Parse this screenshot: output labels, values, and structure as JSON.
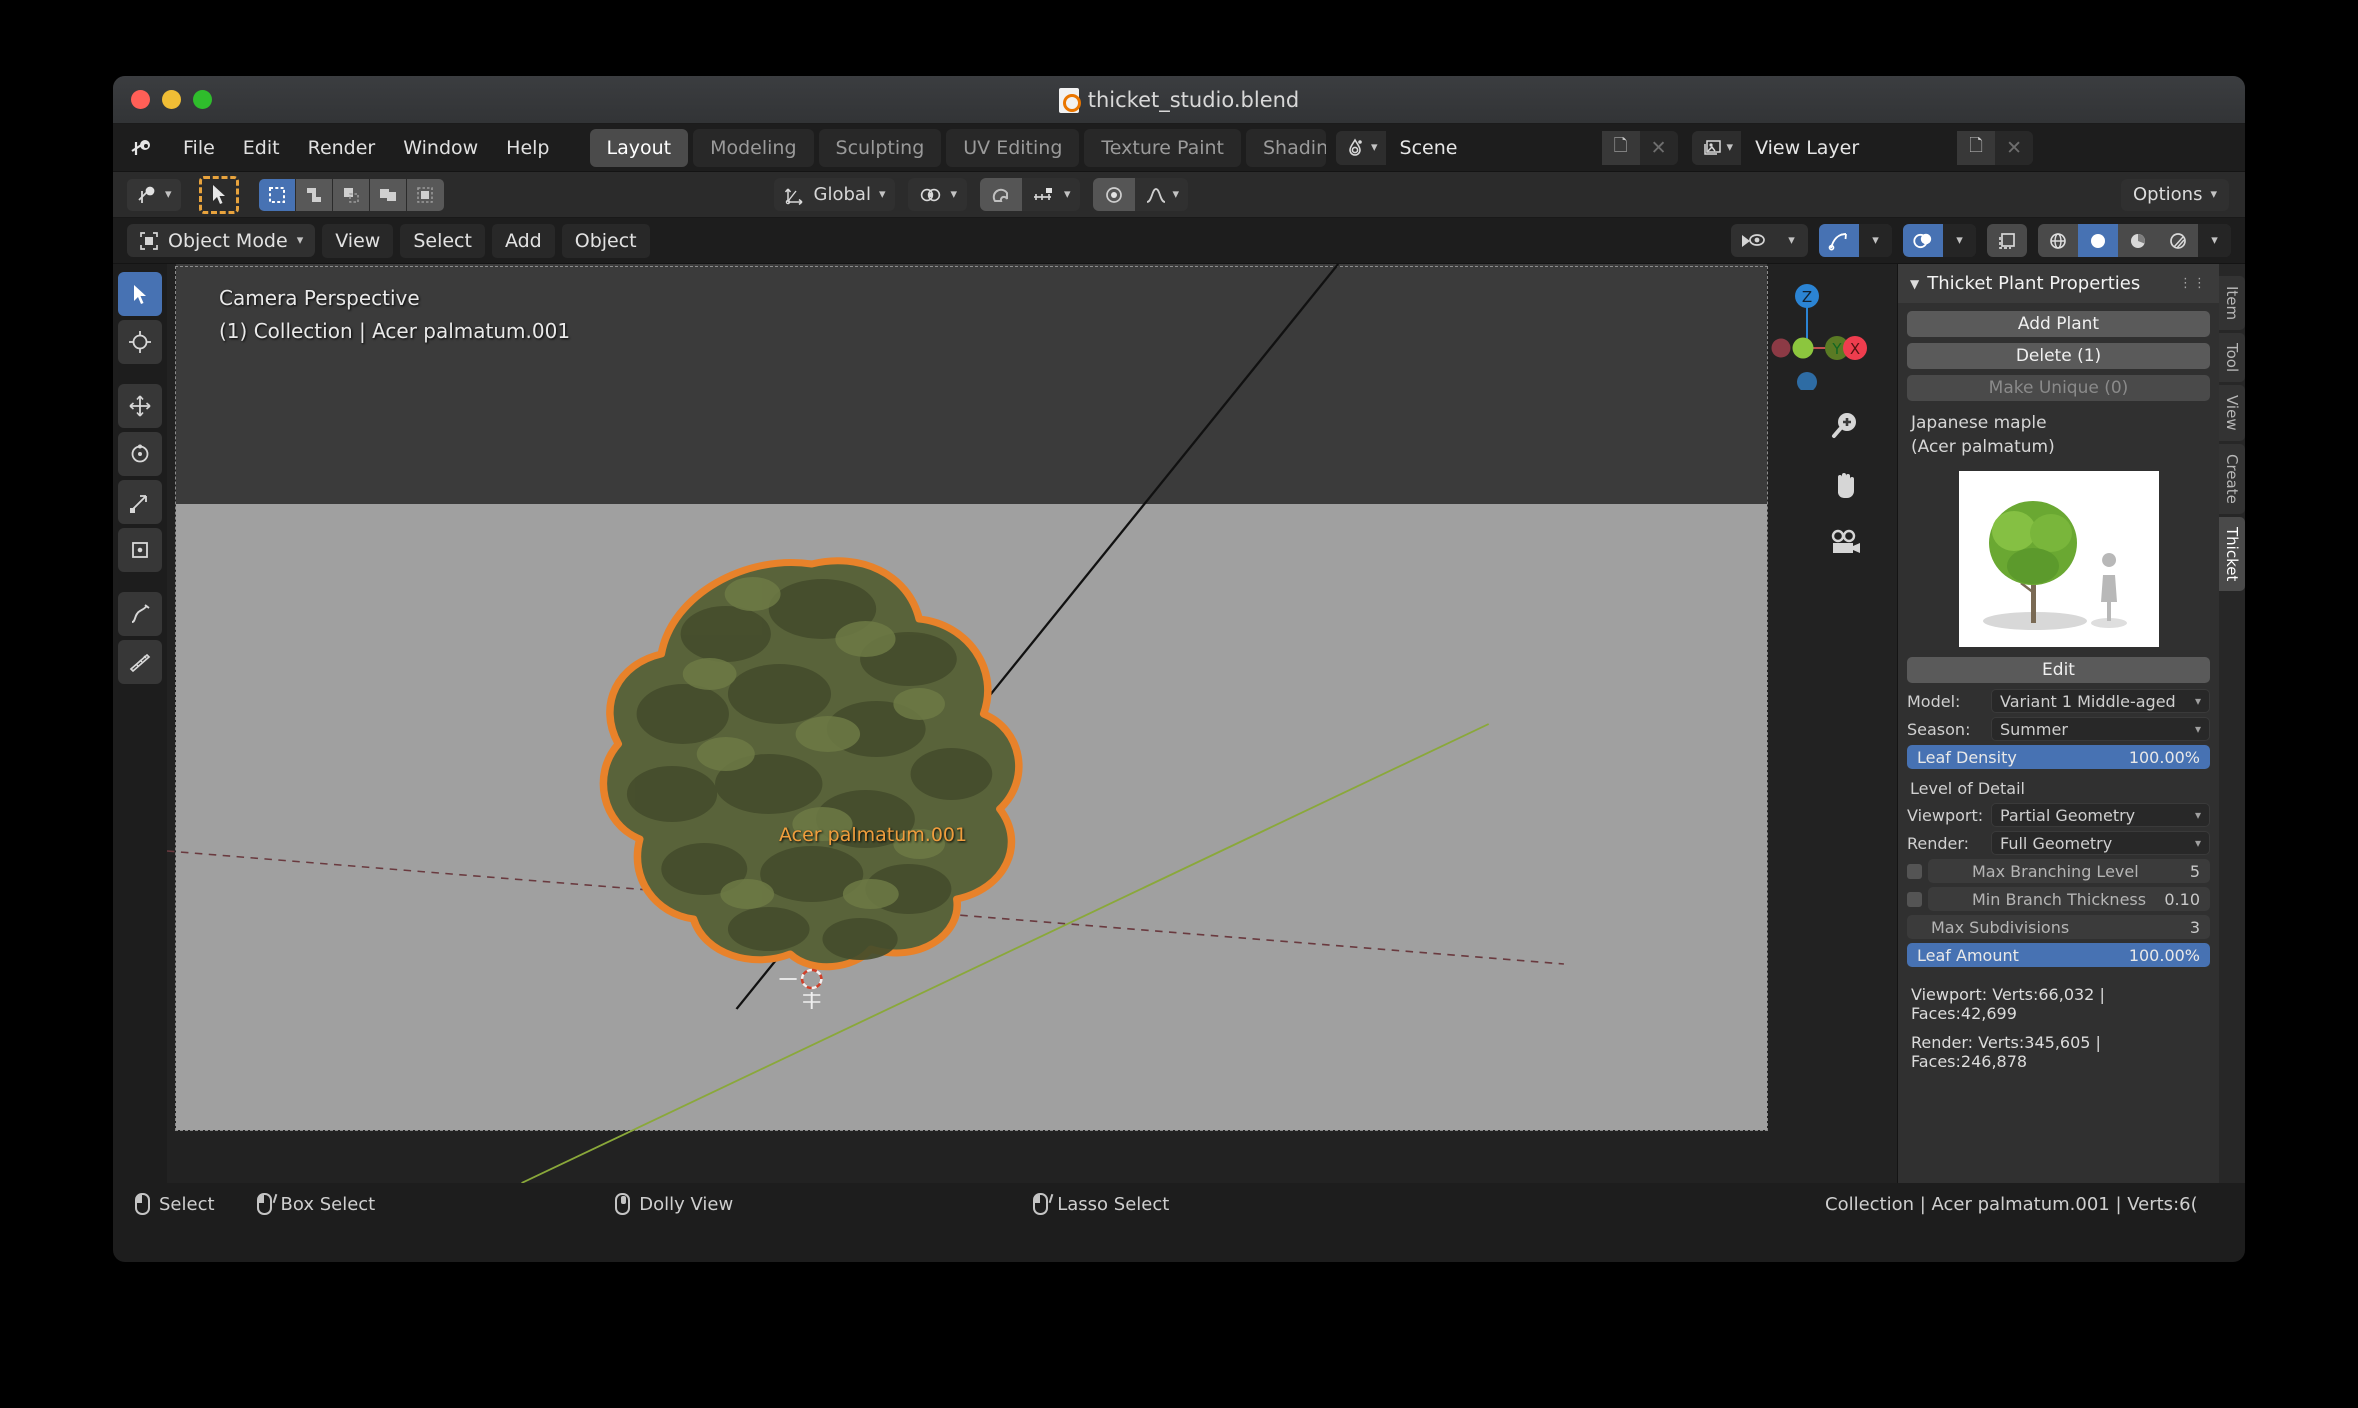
{
  "window": {
    "title": "thicket_studio.blend"
  },
  "topbar": {
    "menus": [
      "File",
      "Edit",
      "Render",
      "Window",
      "Help"
    ],
    "workspaces": [
      {
        "label": "Layout",
        "active": true
      },
      {
        "label": "Modeling",
        "active": false
      },
      {
        "label": "Sculpting",
        "active": false
      },
      {
        "label": "UV Editing",
        "active": false
      },
      {
        "label": "Texture Paint",
        "active": false
      },
      {
        "label": "Shadin",
        "active": false
      }
    ],
    "scene_name": "Scene",
    "view_layer_name": "View Layer"
  },
  "toolheader": {
    "orientation": "Global",
    "options_label": "Options"
  },
  "viewport_header": {
    "mode": "Object Mode",
    "menus": [
      "View",
      "Select",
      "Add",
      "Object"
    ]
  },
  "viewport": {
    "view_name": "Camera Perspective",
    "collection_line": "(1) Collection | Acer palmatum.001",
    "object_label": "Acer palmatum.001",
    "gizmo_axes": [
      "Z",
      "Y",
      "X"
    ]
  },
  "sidebar": {
    "panel_title": "Thicket Plant Properties",
    "buttons": [
      {
        "label": "Add Plant",
        "enabled": true
      },
      {
        "label": "Delete (1)",
        "enabled": true
      },
      {
        "label": "Make Unique (0)",
        "enabled": false
      }
    ],
    "plant_common_name": "Japanese maple",
    "plant_scientific_name": "(Acer palmatum)",
    "edit_label": "Edit",
    "model_row_label": "Model:",
    "model_value": "Variant 1 Middle-aged",
    "season_row_label": "Season:",
    "season_value": "Summer",
    "leaf_density_label": "Leaf Density",
    "leaf_density_value": "100.00%",
    "lod_title": "Level of Detail",
    "viewport_row_label": "Viewport:",
    "viewport_lod_value": "Partial Geometry",
    "render_row_label": "Render:",
    "render_lod_value": "Full Geometry",
    "max_branching_label": "Max Branching Level",
    "max_branching_value": "5",
    "min_thickness_label": "Min Branch Thickness",
    "min_thickness_value": "0.10",
    "max_subdiv_label": "Max Subdivisions",
    "max_subdiv_value": "3",
    "leaf_amount_label": "Leaf Amount",
    "leaf_amount_value": "100.00%",
    "viewport_stats": "Viewport: Verts:66,032 | Faces:42,699",
    "render_stats": "Render: Verts:345,605 | Faces:246,878",
    "vertical_tabs": [
      {
        "label": "Item",
        "active": false
      },
      {
        "label": "Tool",
        "active": false
      },
      {
        "label": "View",
        "active": false
      },
      {
        "label": "Create",
        "active": false
      },
      {
        "label": "Thicket",
        "active": true
      }
    ]
  },
  "statusbar": {
    "items": [
      {
        "label": "Select",
        "icon": "mouse-lmb-icon"
      },
      {
        "label": "Box Select",
        "icon": "mouse-lmb-drag-icon"
      },
      {
        "label": "Dolly View",
        "icon": "mouse-mmb-icon"
      },
      {
        "label": "Lasso Select",
        "icon": "mouse-lmb-drag-icon"
      }
    ],
    "right_text": "Collection | Acer palmatum.001 | Verts:6("
  },
  "colors": {
    "accent_blue": "#4772b3",
    "select_orange": "#f09d3c",
    "axis_x": "#e8404f",
    "axis_y": "#8cc63e",
    "axis_z": "#2b84d4"
  }
}
